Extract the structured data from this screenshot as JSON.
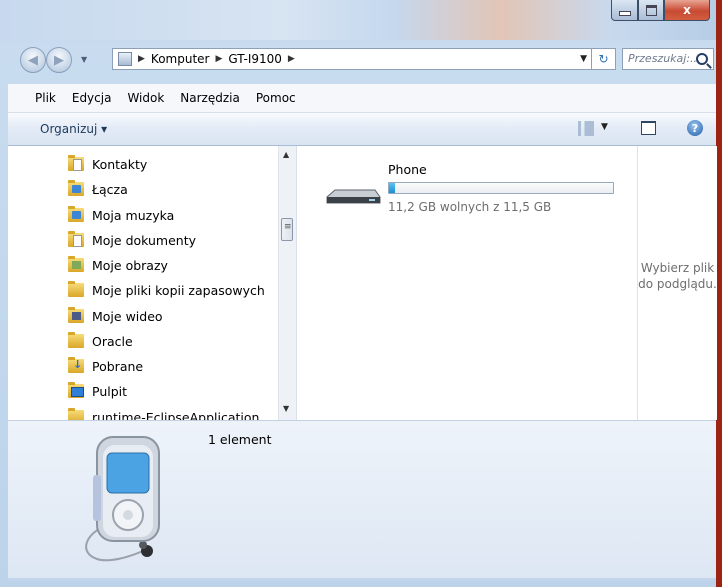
{
  "window": {
    "close_glyph": "x"
  },
  "address": {
    "crumbs": [
      "Komputer",
      "GT-I9100"
    ],
    "search_placeholder": "Przeszukaj:..."
  },
  "menu": [
    "Plik",
    "Edycja",
    "Widok",
    "Narzędzia",
    "Pomoc"
  ],
  "commands": {
    "organize": "Organizuj ▾",
    "help": "?"
  },
  "nav_tree": [
    {
      "label": "Kontakty",
      "icon": "contacts-folder-icon"
    },
    {
      "label": "Łącza",
      "icon": "links-folder-icon"
    },
    {
      "label": "Moja muzyka",
      "icon": "music-folder-icon"
    },
    {
      "label": "Moje dokumenty",
      "icon": "documents-folder-icon"
    },
    {
      "label": "Moje obrazy",
      "icon": "pictures-folder-icon"
    },
    {
      "label": "Moje pliki kopii zapasowych",
      "icon": "folder-icon"
    },
    {
      "label": "Moje wideo",
      "icon": "videos-folder-icon"
    },
    {
      "label": "Oracle",
      "icon": "folder-icon"
    },
    {
      "label": "Pobrane",
      "icon": "downloads-folder-icon"
    },
    {
      "label": "Pulpit",
      "icon": "desktop-folder-icon"
    },
    {
      "label": "runtime-EclipseApplication",
      "icon": "folder-icon"
    }
  ],
  "device": {
    "name": "Phone",
    "free_text": "11,2 GB wolnych z 11,5 GB",
    "used_fraction": 0.026
  },
  "preview": {
    "message": "Wybierz plik do podglądu."
  },
  "details": {
    "count": "1 element"
  },
  "colors": {
    "accent": "#1b8ed1",
    "close_red": "#c74a33"
  }
}
